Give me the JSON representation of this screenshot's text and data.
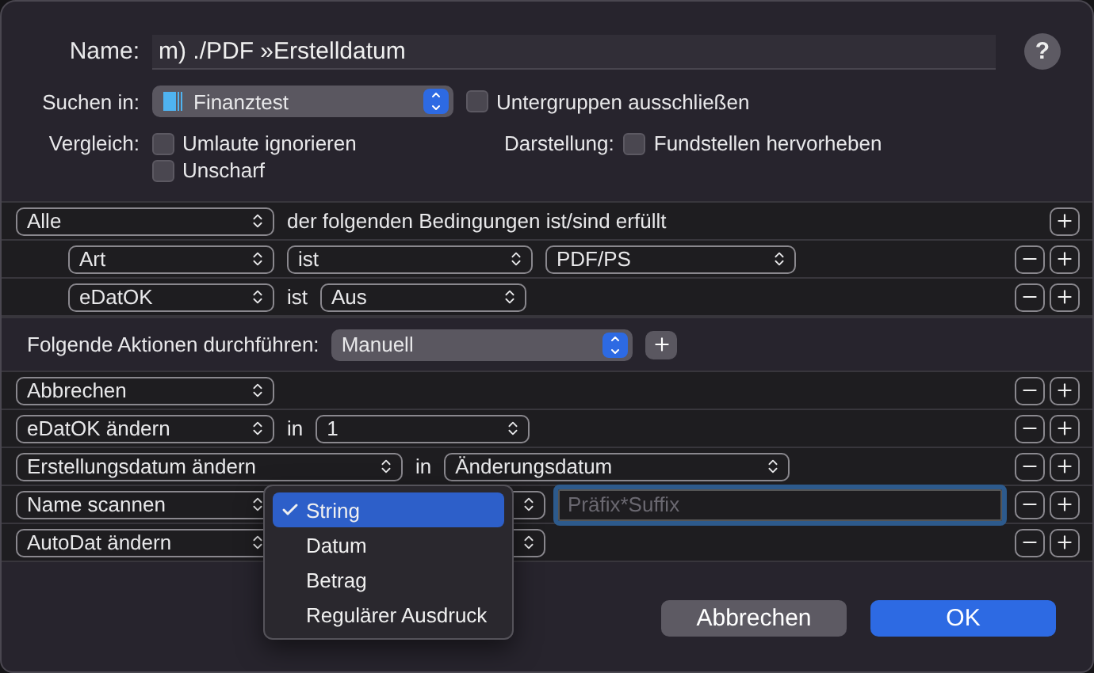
{
  "name_field": {
    "label": "Name:",
    "value": "m) ./PDF »Erstelldatum"
  },
  "help_button": "?",
  "search_in": {
    "label": "Suchen in:",
    "value": "Finanztest"
  },
  "exclude_subgroups": {
    "label": "Untergruppen ausschließen",
    "checked": false
  },
  "compare": {
    "label": "Vergleich:",
    "options": [
      {
        "label": "Umlaute ignorieren",
        "checked": false
      },
      {
        "label": "Unscharf",
        "checked": false
      }
    ]
  },
  "display": {
    "label": "Darstellung:",
    "option": {
      "label": "Fundstellen hervorheben",
      "checked": false
    }
  },
  "conditions": {
    "match": "Alle",
    "text": "der folgenden Bedingungen ist/sind erfüllt",
    "rows": [
      {
        "items": [
          {
            "kind": "popup",
            "value": "Art"
          },
          {
            "kind": "popup",
            "value": "ist"
          },
          {
            "kind": "popup",
            "value": "PDF/PS"
          }
        ]
      },
      {
        "items": [
          {
            "kind": "popup",
            "value": "eDatOK"
          },
          {
            "kind": "label",
            "value": "ist"
          },
          {
            "kind": "popup",
            "value": "Aus"
          }
        ]
      }
    ]
  },
  "actions": {
    "label": "Folgende Aktionen durchführen:",
    "mode": "Manuell",
    "rows": [
      {
        "items": [
          {
            "kind": "popup",
            "value": "Abbrechen"
          }
        ]
      },
      {
        "items": [
          {
            "kind": "popup",
            "value": "eDatOK ändern"
          },
          {
            "kind": "label",
            "value": "in"
          },
          {
            "kind": "popup",
            "value": "1"
          }
        ]
      },
      {
        "items": [
          {
            "kind": "popup",
            "value": "Erstellungsdatum ändern"
          },
          {
            "kind": "label",
            "value": "in"
          },
          {
            "kind": "popup",
            "value": "Änderungsdatum"
          }
        ]
      },
      {
        "items": [
          {
            "kind": "popup",
            "value": "Name scannen"
          },
          {
            "kind": "covered"
          },
          {
            "kind": "field",
            "placeholder": "Präfix*Suffix"
          }
        ]
      },
      {
        "items": [
          {
            "kind": "popup",
            "value": "AutoDat ändern"
          },
          {
            "kind": "covered"
          }
        ]
      }
    ]
  },
  "menu": {
    "items": [
      {
        "label": "String",
        "selected": true
      },
      {
        "label": "Datum",
        "selected": false
      },
      {
        "label": "Betrag",
        "selected": false
      },
      {
        "label": "Regulärer Ausdruck",
        "selected": false
      }
    ]
  },
  "buttons": [
    {
      "label": "Abbrechen",
      "kind": "secondary"
    },
    {
      "label": "OK",
      "kind": "primary"
    }
  ]
}
